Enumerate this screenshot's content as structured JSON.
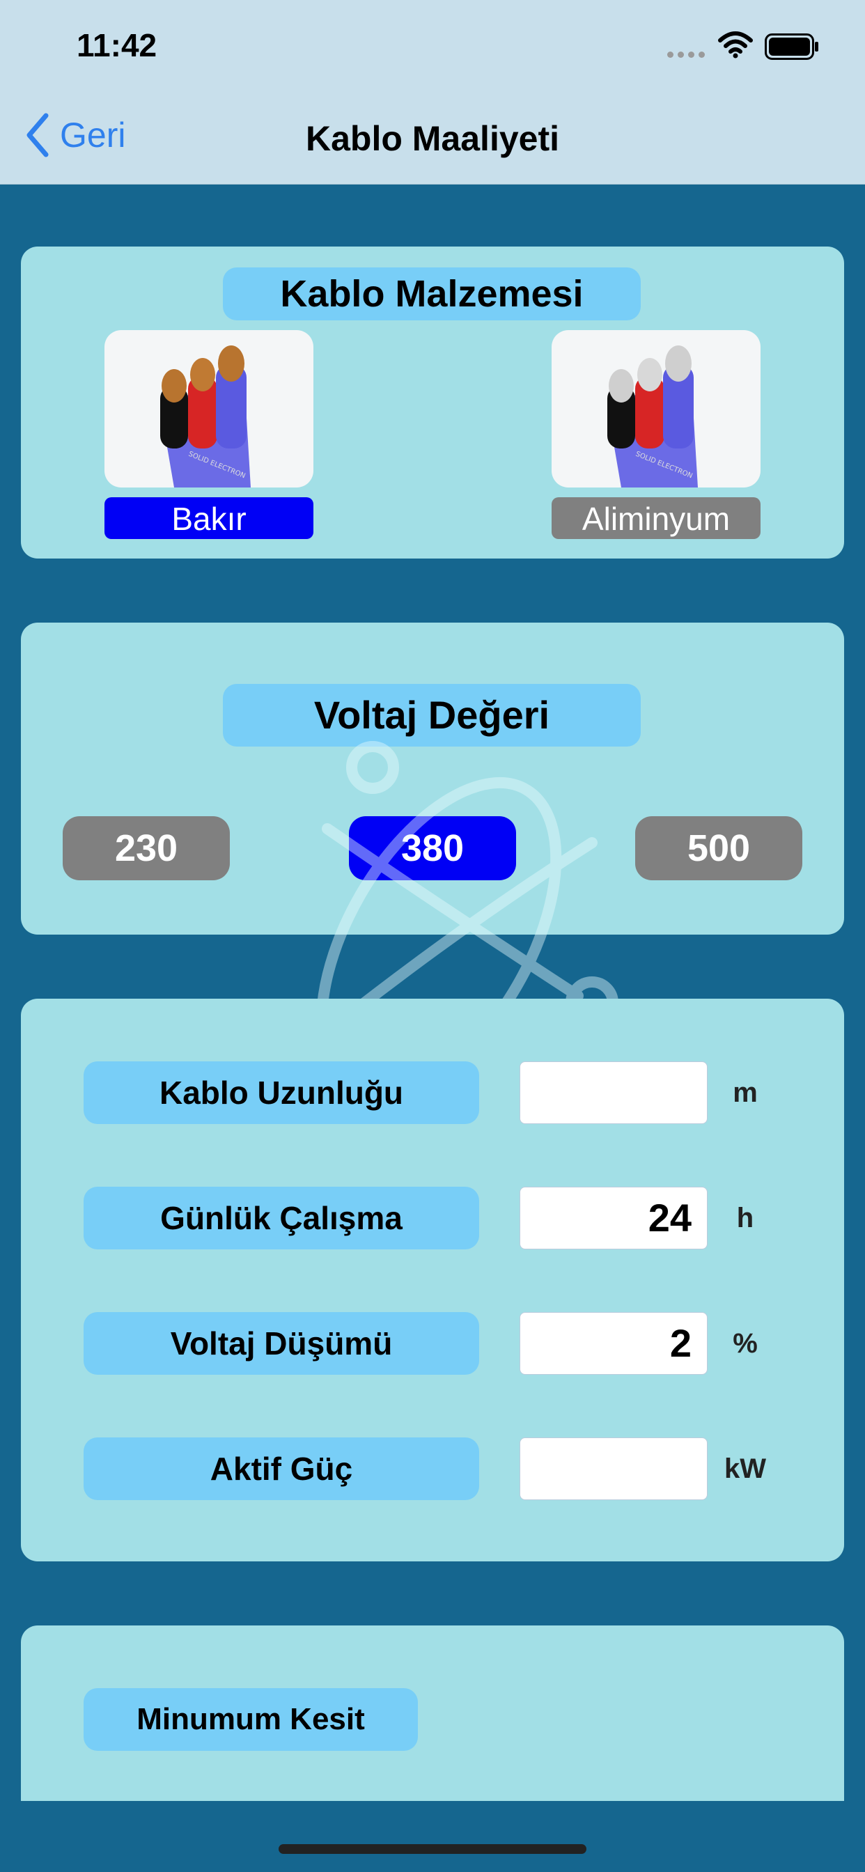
{
  "status": {
    "time": "11:42"
  },
  "nav": {
    "back_label": "Geri",
    "title": "Kablo Maaliyeti"
  },
  "material": {
    "title": "Kablo Malzemesi",
    "options": [
      {
        "label": "Bakır",
        "selected": true
      },
      {
        "label": "Aliminyum",
        "selected": false
      }
    ]
  },
  "voltage": {
    "title": "Voltaj Değeri",
    "options": [
      {
        "label": "230",
        "selected": false
      },
      {
        "label": "380",
        "selected": true
      },
      {
        "label": "500",
        "selected": false
      }
    ]
  },
  "inputs": [
    {
      "label": "Kablo Uzunluğu",
      "value": "",
      "unit": "m"
    },
    {
      "label": "Günlük Çalışma",
      "value": "24",
      "unit": "h"
    },
    {
      "label": "Voltaj Düşümü",
      "value": "2",
      "unit": "%"
    },
    {
      "label": "Aktif Güç",
      "value": "",
      "unit": "kW"
    }
  ],
  "result": {
    "label": "Minumum Kesit"
  },
  "colors": {
    "background": "#15668F",
    "card": "#A2DFE6",
    "pill": "#78CEF7",
    "selected": "#0000F5",
    "unselected": "#808080",
    "nav_accent": "#2F80ED"
  }
}
